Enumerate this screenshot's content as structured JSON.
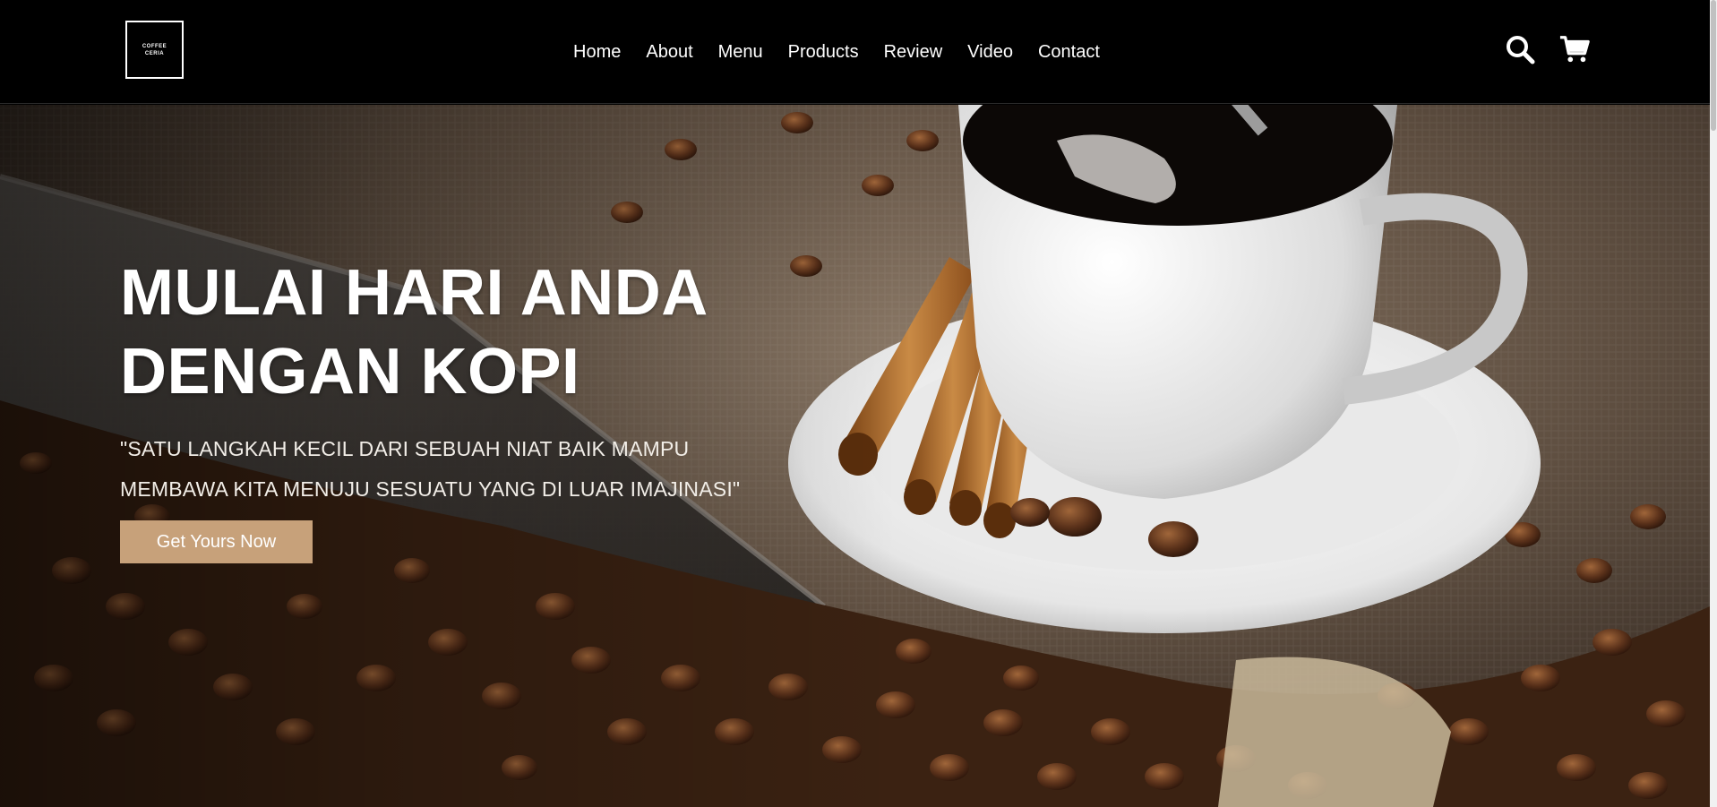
{
  "logo": {
    "line1": "COFFEE",
    "line2": "CERIA"
  },
  "nav": {
    "items": [
      {
        "label": "Home"
      },
      {
        "label": "About"
      },
      {
        "label": "Menu"
      },
      {
        "label": "Products"
      },
      {
        "label": "Review"
      },
      {
        "label": "Video"
      },
      {
        "label": "Contact"
      }
    ]
  },
  "header_icons": {
    "search": "search-icon",
    "cart": "cart-icon"
  },
  "hero": {
    "title_line1": "MULAI HARI ANDA",
    "title_line2": "DENGAN KOPI",
    "quote_line1": "\"SATU LANGKAH KECIL DARI SEBUAH NIAT BAIK MAMPU",
    "quote_line2": "MEMBAWA KITA MENUJU SESUATU YANG DI LUAR IMAJINASI\"",
    "cta_label": "Get Yours Now"
  },
  "colors": {
    "header_bg": "#000000",
    "accent": "#c7a17a",
    "text": "#ffffff"
  }
}
